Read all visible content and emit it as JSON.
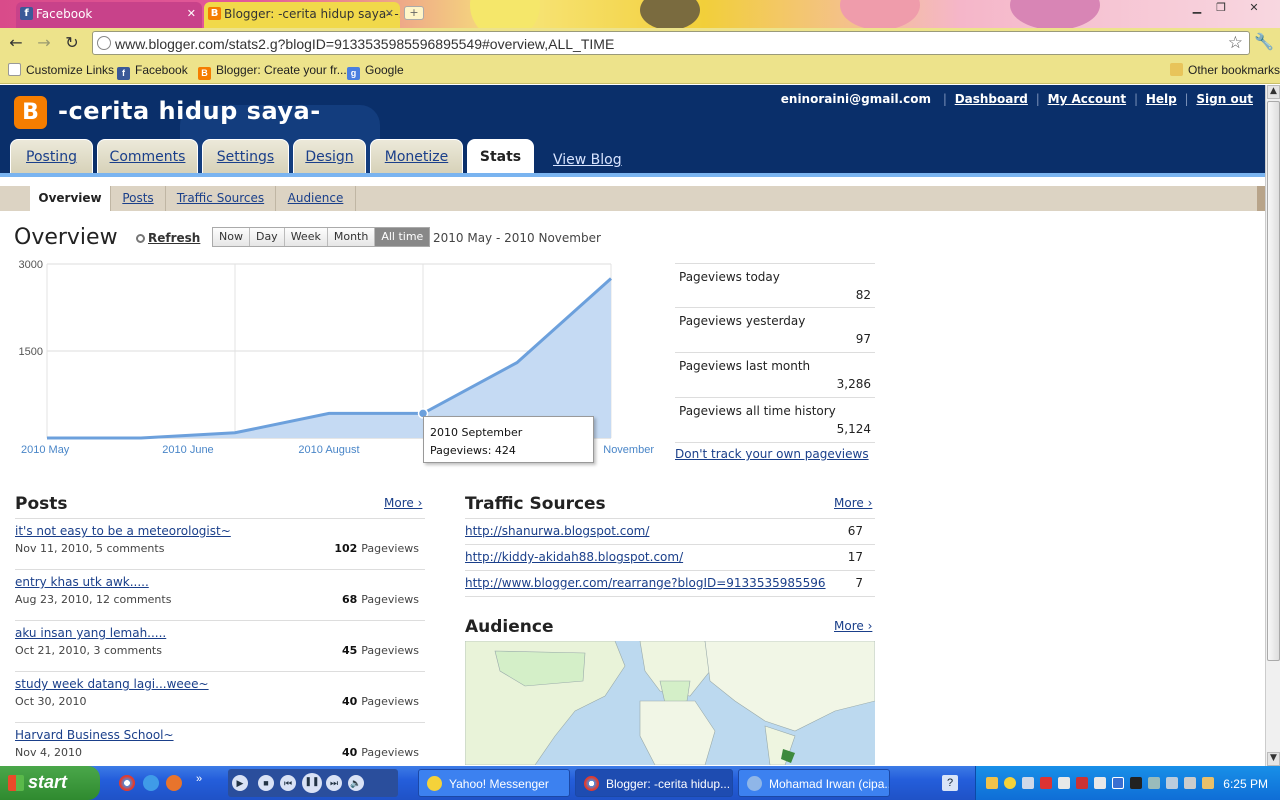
{
  "browser": {
    "tabs": [
      {
        "label": "Facebook",
        "icon": "facebook-icon"
      },
      {
        "label": "Blogger: -cerita hidup saya- -...",
        "icon": "blogger-icon"
      }
    ],
    "url": "www.blogger.com/stats2.g?blogID=9133535985596895549#overview,ALL_TIME",
    "bookmarks": [
      {
        "label": "Customize Links",
        "icon": "page-icon"
      },
      {
        "label": "Facebook",
        "icon": "facebook-icon"
      },
      {
        "label": "Blogger: Create your fr...",
        "icon": "blogger-icon"
      },
      {
        "label": "Google",
        "icon": "google-icon"
      }
    ],
    "other_bookmarks": "Other bookmarks"
  },
  "header": {
    "blog_title": "-cerita hidup saya-",
    "email": "eninoraini@gmail.com",
    "links": [
      "Dashboard",
      "My Account",
      "Help",
      "Sign out"
    ],
    "main_tabs": [
      "Posting",
      "Comments",
      "Settings",
      "Design",
      "Monetize",
      "Stats"
    ],
    "active_tab": "Stats",
    "view_blog": "View Blog",
    "sub_tabs": [
      "Overview",
      "Posts",
      "Traffic Sources",
      "Audience"
    ],
    "active_sub_tab": "Overview"
  },
  "overview": {
    "title": "Overview",
    "refresh": "Refresh",
    "ranges": [
      "Now",
      "Day",
      "Week",
      "Month",
      "All time"
    ],
    "active_range": "All time",
    "date_range": "2010 May - 2010 November",
    "tooltip_title": "2010 September",
    "tooltip_value": "Pageviews: 424",
    "stats": [
      {
        "label": "Pageviews today",
        "value": "82"
      },
      {
        "label": "Pageviews yesterday",
        "value": "97"
      },
      {
        "label": "Pageviews last month",
        "value": "3,286"
      },
      {
        "label": "Pageviews all time history",
        "value": "5,124"
      }
    ],
    "dont_track": "Don't track your own pageviews"
  },
  "chart_data": {
    "type": "area",
    "x": [
      "2010 May",
      "2010 June",
      "2010 July",
      "2010 August",
      "2010 September",
      "2010 October",
      "2010 November"
    ],
    "y": [
      0,
      0,
      90,
      424,
      424,
      1300,
      2750
    ],
    "xticks": [
      "2010 May",
      "2010 June",
      "2010 August",
      "2010 October",
      "2010 November"
    ],
    "yticks": [
      "3000",
      "1500"
    ],
    "ylim": [
      0,
      3000
    ],
    "highlight_index": 4,
    "color": "#6ca0dc",
    "fill": "#c5daf3"
  },
  "posts": {
    "heading": "Posts",
    "more": "More ›",
    "items": [
      {
        "title": "it's not easy to be a meteorologist~",
        "meta": "Nov 11, 2010, 5 comments",
        "count": "102",
        "unit": "Pageviews"
      },
      {
        "title": "entry khas utk awk.....",
        "meta": "Aug 23, 2010, 12 comments",
        "count": "68",
        "unit": "Pageviews"
      },
      {
        "title": "aku insan yang lemah.....",
        "meta": "Oct 21, 2010, 3 comments",
        "count": "45",
        "unit": "Pageviews"
      },
      {
        "title": "study week datang lagi...weee~",
        "meta": "Oct 30, 2010",
        "count": "40",
        "unit": "Pageviews"
      },
      {
        "title": "Harvard Business School~",
        "meta": "Nov 4, 2010",
        "count": "40",
        "unit": "Pageviews"
      }
    ]
  },
  "traffic": {
    "heading": "Traffic Sources",
    "more": "More ›",
    "items": [
      {
        "url": "http://shanurwa.blogspot.com/",
        "count": "67"
      },
      {
        "url": "http://kiddy-akidah88.blogspot.com/",
        "count": "17"
      },
      {
        "url": "http://www.blogger.com/rearrange?blogID=9133535985596",
        "count": "7"
      }
    ]
  },
  "audience": {
    "heading": "Audience",
    "more": "More ›"
  },
  "taskbar": {
    "start": "start",
    "buttons": [
      {
        "label": "Yahoo! Messenger",
        "icon": "yahoo-messenger-icon"
      },
      {
        "label": "Blogger: -cerita hidup...",
        "icon": "chrome-icon"
      },
      {
        "label": "Mohamad Irwan (cipa...",
        "icon": "chat-icon"
      }
    ],
    "clock": "6:25 PM"
  }
}
